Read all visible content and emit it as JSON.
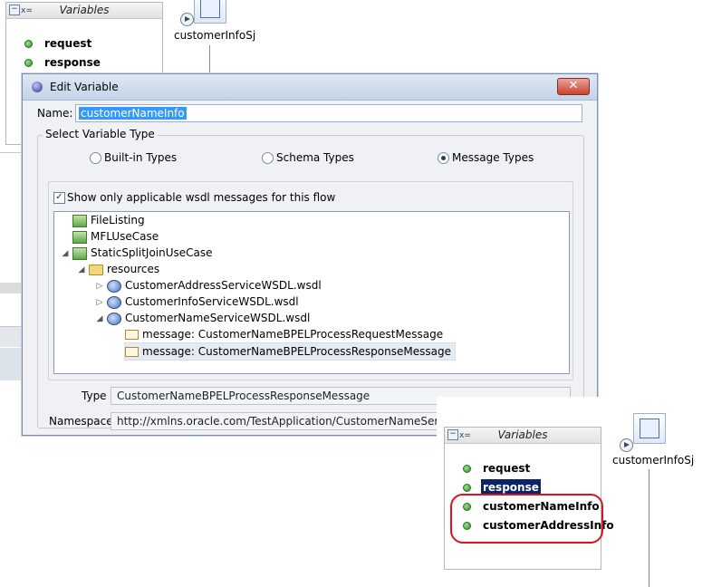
{
  "bg_panel_top": {
    "title": "Variables",
    "items": [
      "request",
      "response"
    ]
  },
  "bg_flow_top": {
    "label": "customerInfoSj"
  },
  "dialog": {
    "title": "Edit Variable",
    "close_glyph": "✕",
    "name_label": "Name:",
    "name_value": "customerNameInfo",
    "group_label": "Select Variable Type",
    "radios": [
      "Built-in Types",
      "Schema Types",
      "Message Types"
    ],
    "selected_radio": "Message Types",
    "checkbox_label": "Show only applicable wsdl messages for this flow",
    "checkbox_checked": true,
    "tree": [
      {
        "label": "FileListing"
      },
      {
        "label": "MFLUseCase"
      },
      {
        "label": "StaticSplitJoinUseCase"
      },
      {
        "label": "resources"
      },
      {
        "label": "CustomerAddressServiceWSDL.wsdl"
      },
      {
        "label": "CustomerInfoServiceWSDL.wsdl"
      },
      {
        "label": "CustomerNameServiceWSDL.wsdl"
      },
      {
        "label": "message: CustomerNameBPELProcessRequestMessage"
      },
      {
        "label": "message: CustomerNameBPELProcessResponseMessage"
      }
    ],
    "type_label": "Type",
    "type_value": "CustomerNameBPELProcessResponseMessage",
    "namespace_label": "Namespace",
    "namespace_value": "http://xmlns.oracle.com/TestApplication/CustomerNameService/C"
  },
  "overlay_panel": {
    "title": "Variables",
    "items": [
      "request",
      "response",
      "customerNameInfo",
      "customerAddressInfo"
    ],
    "highlight_color": "#d9141e"
  },
  "overlay_flow": {
    "label": "customerInfoSj"
  }
}
